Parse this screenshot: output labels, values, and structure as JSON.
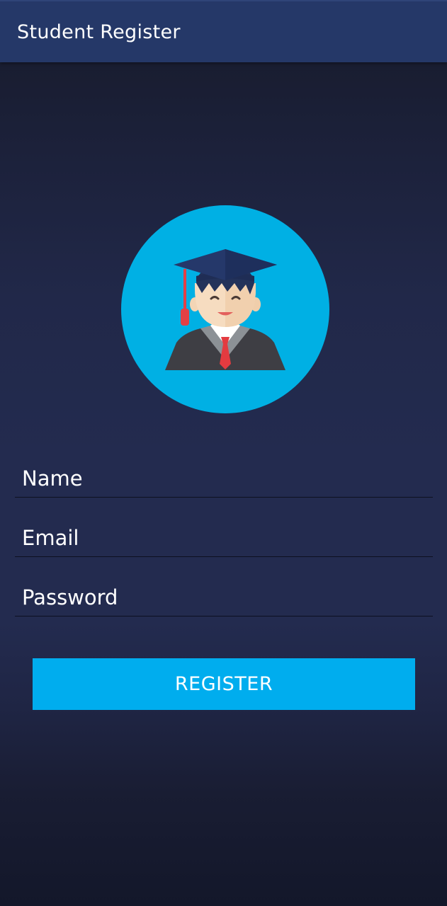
{
  "app_bar": {
    "title": "Student Register",
    "background_color": "#253868"
  },
  "avatar": {
    "icon": "graduate-student-icon",
    "circle_color": "#00b0e4"
  },
  "form": {
    "name": {
      "placeholder": "Name",
      "value": ""
    },
    "email": {
      "placeholder": "Email",
      "value": ""
    },
    "password": {
      "placeholder": "Password",
      "value": ""
    },
    "register_label": "REGISTER",
    "register_color": "#00adee"
  }
}
